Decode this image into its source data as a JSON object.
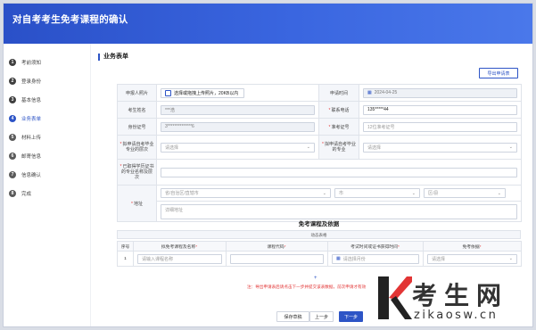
{
  "header": {
    "title": "对自考考生免考课程的确认"
  },
  "sidebar": {
    "steps": [
      {
        "num": "1",
        "label": "考前须知"
      },
      {
        "num": "2",
        "label": "登录身份"
      },
      {
        "num": "3",
        "label": "基本信息"
      },
      {
        "num": "4",
        "label": "业务表单"
      },
      {
        "num": "5",
        "label": "材料上传"
      },
      {
        "num": "6",
        "label": "邮寄信息"
      },
      {
        "num": "7",
        "label": "信息确认"
      },
      {
        "num": "8",
        "label": "完成"
      }
    ]
  },
  "main": {
    "section_title": "业务表单",
    "export_button": "导出申请表",
    "form": {
      "photo_label": "申报人照片",
      "photo_hint": "选择或拖拽上传照片，20KB以内",
      "apply_time_label": "申请时间",
      "apply_time_value": "2024-04-25",
      "name_label": "考生姓名",
      "name_value": "***浩",
      "phone_label": "联系电话",
      "phone_value": "135*****44",
      "id_label": "身份证号",
      "id_value": "3**************6",
      "exam_no_label": "准考证号",
      "exam_no_placeholder": "12位准考证号",
      "level_label": "拟申请自考毕业专业的层次",
      "level_placeholder": "请选择",
      "major_label": "拟申请自考毕业的专业",
      "major_placeholder": "请选择",
      "prior_label": "已取得学历证书的专业名称及层次",
      "address_label": "地址",
      "prov_placeholder": "省/自治区/直辖市",
      "city_placeholder": "市",
      "district_placeholder": "区/县",
      "detail_placeholder": "详细地址"
    },
    "courses": {
      "title": "免考课程及依据",
      "subtitle": "动态表格",
      "headers": [
        "序号",
        "拟免考课程及名称",
        "课程代码",
        "考试时间或证书获得时间",
        "免考依据"
      ],
      "rows": [
        {
          "index": "1",
          "name_placeholder": "请输入课程名称",
          "date_placeholder": "请选择月份",
          "basis_placeholder": "请选择"
        }
      ],
      "add": "+"
    },
    "note": "注：导出申请表后请点击下一步并提交该表数据，前次申请才有效",
    "buttons": {
      "save": "保存草稿",
      "prev": "上一步",
      "next": "下一步"
    }
  },
  "watermark": {
    "text": "考生网",
    "url": "zikaosw.cn"
  }
}
